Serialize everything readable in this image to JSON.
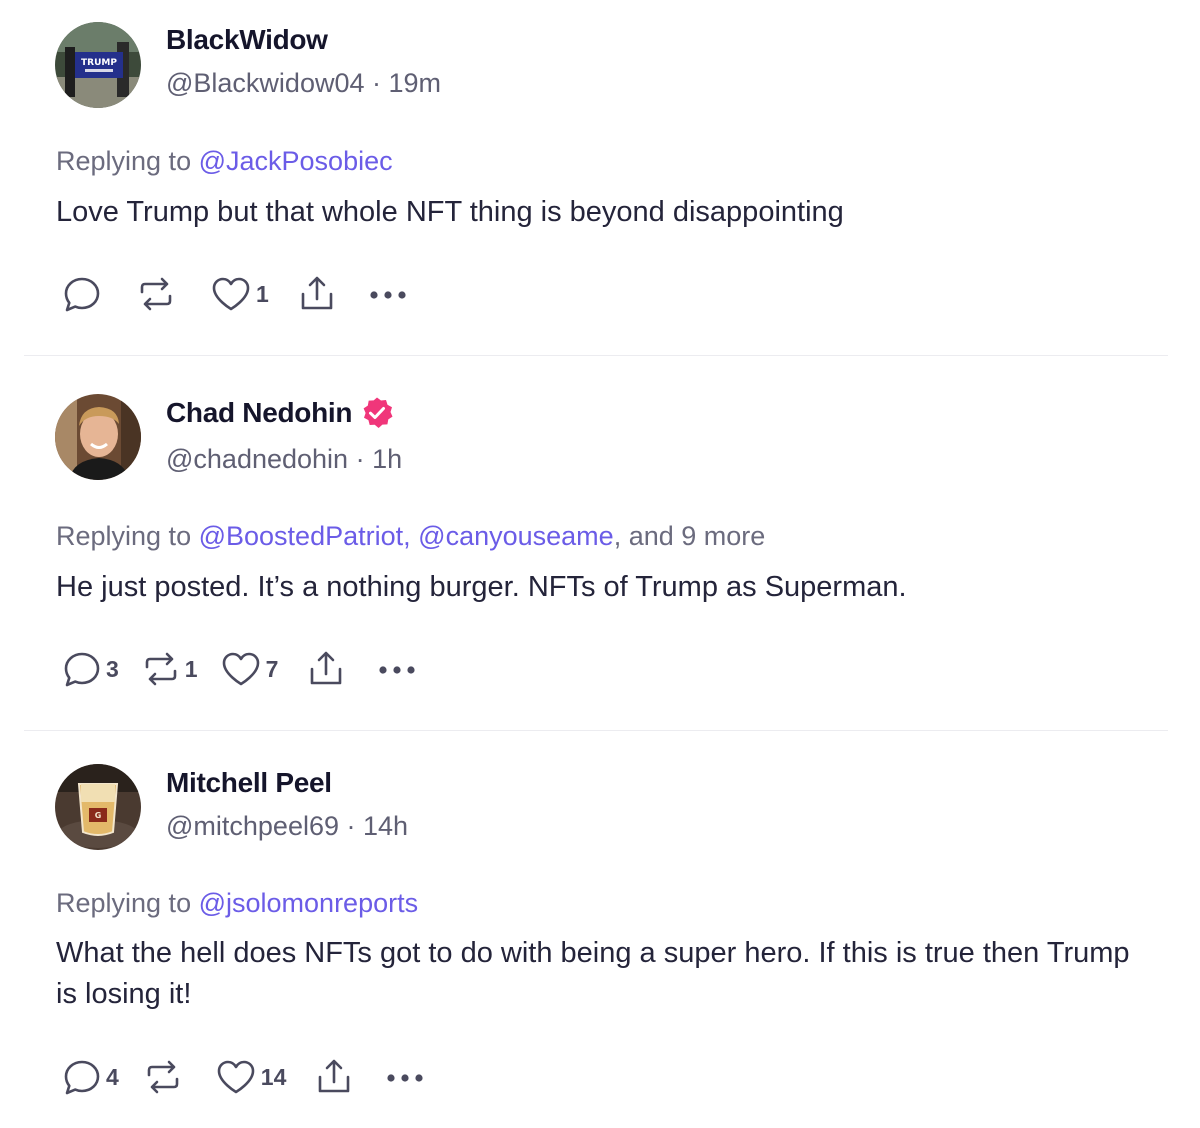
{
  "posts": [
    {
      "display_name": "BlackWidow",
      "verified": false,
      "handle": "@Blackwidow04",
      "time": "19m",
      "replying_label": "Replying to",
      "mentions": [
        "@JackPosobiec"
      ],
      "mentions_suffix": "",
      "text": "Love Trump but that whole NFT thing is beyond disappointing",
      "avatar_sign_text": "TRUMP",
      "counts": {
        "replies": "",
        "reposts": "",
        "likes": "1"
      }
    },
    {
      "display_name": "Chad Nedohin",
      "verified": true,
      "handle": "@chadnedohin",
      "time": "1h",
      "replying_label": "Replying to",
      "mentions": [
        "@BoostedPatriot",
        "@canyouseame"
      ],
      "mentions_suffix": "and 9 more",
      "text": "He just posted. It’s a nothing burger. NFTs of Trump as Superman.",
      "counts": {
        "replies": "3",
        "reposts": "1",
        "likes": "7"
      }
    },
    {
      "display_name": "Mitchell Peel",
      "verified": false,
      "handle": "@mitchpeel69",
      "time": "14h",
      "replying_label": "Replying to",
      "mentions": [
        "@jsolomonreports"
      ],
      "mentions_suffix": "",
      "text": "What the hell does NFTs got to do with being a super hero. If this is true then Trump is losing it!",
      "counts": {
        "replies": "4",
        "reposts": "",
        "likes": "14"
      }
    }
  ],
  "separator": " · ",
  "colors": {
    "mention": "#6b5ce7",
    "verified_badge": "#f0367a",
    "name": "#15152b",
    "muted": "#5f5f73"
  },
  "icons": [
    "reply-icon",
    "repost-icon",
    "like-icon",
    "share-icon",
    "more-icon",
    "verified-icon"
  ]
}
